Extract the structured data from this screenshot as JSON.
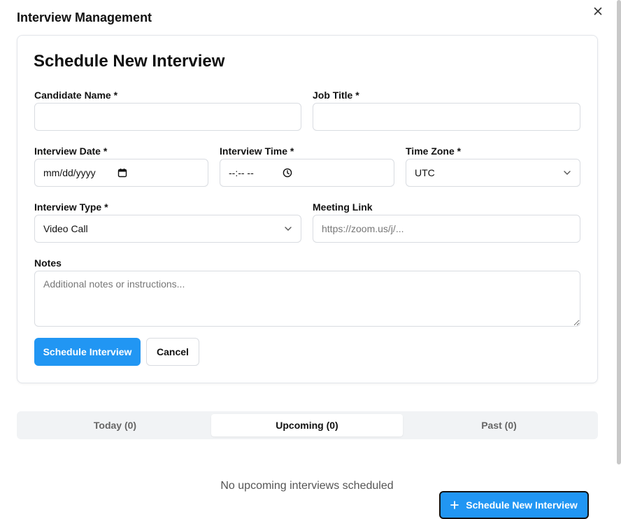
{
  "app": {
    "title": "Interview Management"
  },
  "form": {
    "title": "Schedule New Interview",
    "candidate_name": {
      "label": "Candidate Name *",
      "value": ""
    },
    "job_title": {
      "label": "Job Title *",
      "value": ""
    },
    "interview_date": {
      "label": "Interview Date *",
      "display": "mm/dd/yyyy"
    },
    "interview_time": {
      "label": "Interview Time *",
      "display": "--:-- --"
    },
    "time_zone": {
      "label": "Time Zone *",
      "selected": "UTC"
    },
    "interview_type": {
      "label": "Interview Type *",
      "selected": "Video Call"
    },
    "meeting_link": {
      "label": "Meeting Link",
      "placeholder": "https://zoom.us/j/..."
    },
    "notes": {
      "label": "Notes",
      "placeholder": "Additional notes or instructions..."
    },
    "submit_label": "Schedule Interview",
    "cancel_label": "Cancel"
  },
  "tabs": [
    {
      "label": "Today (0)",
      "active": false
    },
    {
      "label": "Upcoming (0)",
      "active": true
    },
    {
      "label": "Past (0)",
      "active": false
    }
  ],
  "empty_state": "No upcoming interviews scheduled",
  "fab": {
    "label": "Schedule New Interview",
    "icon": "plus-icon"
  },
  "colors": {
    "primary": "#2196f3",
    "border": "#d9dce1",
    "tab_bg": "#f1f3f5"
  }
}
